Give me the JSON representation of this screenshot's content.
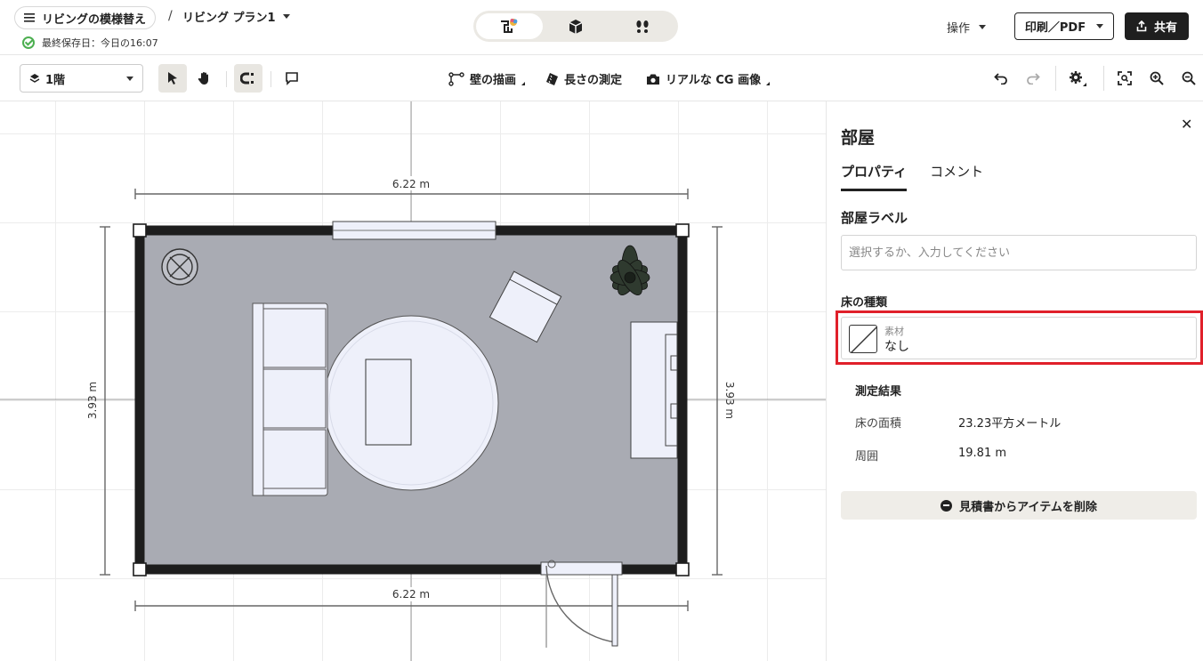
{
  "header": {
    "project_name": "リビングの模様替え",
    "separator": "/",
    "plan_name": "リビング プラン1",
    "saved_text": "最終保存日：今日の16:07",
    "operations_label": "操作",
    "print_label": "印刷／PDF",
    "share_label": "共有"
  },
  "toolbar": {
    "floor_label": "1階",
    "draw_wall_label": "壁の描画",
    "measure_label": "長さの測定",
    "render_label": "リアルな CG 画像"
  },
  "canvas": {
    "dim_top": "6.22 m",
    "dim_bottom": "6.22 m",
    "dim_left": "3.93 m",
    "dim_right": "3.93 m"
  },
  "panel": {
    "title": "部屋",
    "tabs": [
      "プロパティ",
      "コメント"
    ],
    "room_label_heading": "部屋ラベル",
    "room_label_placeholder": "選択するか、入力してください",
    "room_label_value": "",
    "floor_type_heading": "床の種類",
    "material_caption": "素材",
    "material_value": "なし",
    "measure_title": "測定結果",
    "measure_rows": [
      {
        "key": "床の面積",
        "value": "23.23平方メートル"
      },
      {
        "key": "周囲",
        "value": "19.81 m"
      }
    ],
    "remove_label": "見積書からアイテムを削除"
  },
  "colors": {
    "highlight": "#e0202a",
    "room_floor": "#a9abb3",
    "wall": "#1d1d1d",
    "furniture": "#eef0fa"
  }
}
